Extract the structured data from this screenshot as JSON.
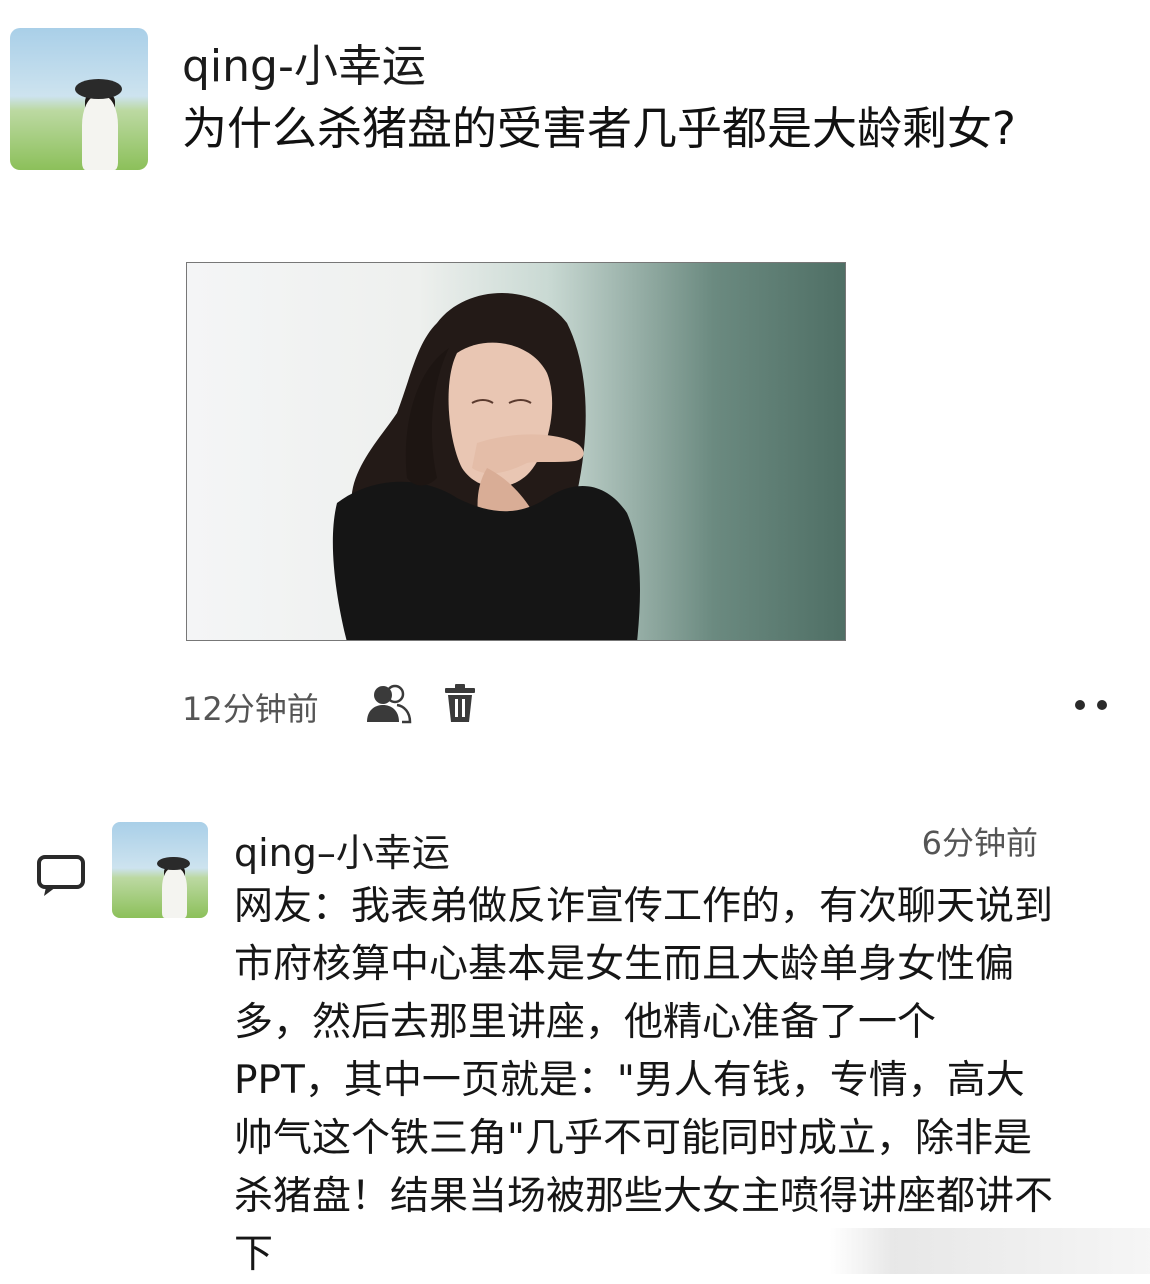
{
  "post": {
    "author": "qing-小幸运",
    "title": "为什么杀猪盘的受害者几乎都是大龄剩女?",
    "time_ago": "12分钟前",
    "icons": {
      "privacy": "people-icon",
      "delete": "trash-icon",
      "more": "more-dots-icon"
    }
  },
  "comment": {
    "author": "qing–小幸运",
    "time_ago": "6分钟前",
    "text": "网友：我表弟做反诈宣传工作的，有次聊天说到市府核算中心基本是女生而且大龄单身女性偏多，然后去那里讲座，他精心准备了一个 PPT，其中一页就是：\"男人有钱，专情，高大帅气这个铁三角\"几乎不可能同时成立，除非是杀猪盘！结果当场被那些大女主喷得讲座都讲不下",
    "icons": {
      "comment": "comment-bubble-icon"
    }
  },
  "colors": {
    "background": "#ffffff",
    "text": "#111111",
    "muted": "#555555",
    "icon": "#3a3a3a"
  }
}
